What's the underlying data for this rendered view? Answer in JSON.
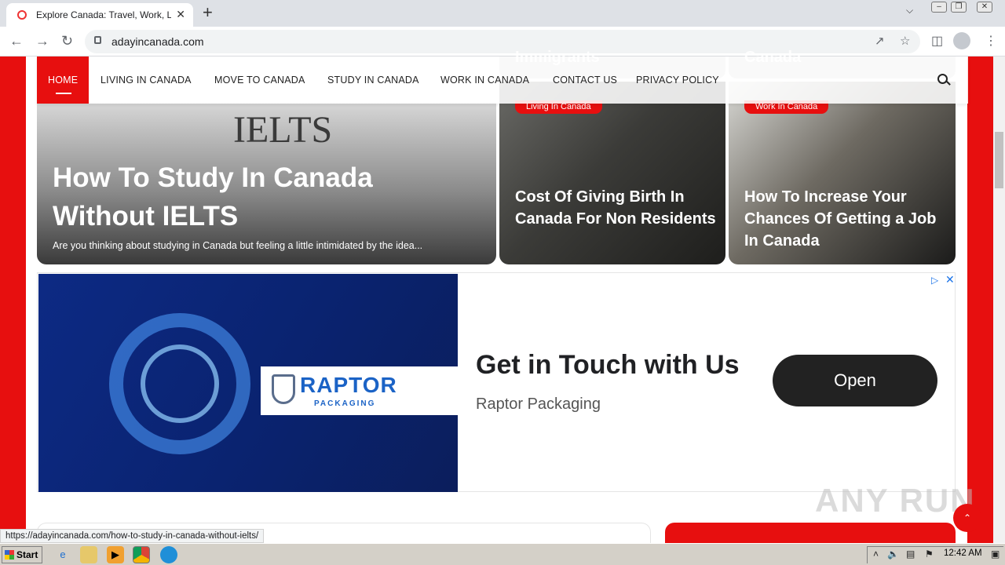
{
  "browser": {
    "tab_title": "Explore Canada: Travel, Work, Live, ...",
    "new_tab": "+",
    "url": "adayincanada.com",
    "status_url": "https://adayincanada.com/how-to-study-in-canada-without-ielts/"
  },
  "nav": {
    "items": [
      {
        "label": "HOME",
        "active": true
      },
      {
        "label": "LIVING IN CANADA",
        "active": false
      },
      {
        "label": "MOVE TO CANADA",
        "active": false
      },
      {
        "label": "STUDY IN CANADA",
        "active": false
      },
      {
        "label": "WORK IN CANADA",
        "active": false
      },
      {
        "label": "CONTACT US",
        "active": false
      },
      {
        "label": "PRIVACY POLICY",
        "active": false
      }
    ]
  },
  "upper_cards": [
    "Immigrants",
    "Canada"
  ],
  "featured": {
    "image_text": "IELTS",
    "title": "How To Study In Canada Without IELTS",
    "excerpt": "Are you thinking about studying in Canada but feeling a little intimidated by the idea..."
  },
  "cards": [
    {
      "category": "Living In Canada",
      "title": "Cost Of Giving Birth In Canada For Non Residents"
    },
    {
      "category": "Work In Canada",
      "title": "How To Increase Your Chances Of Getting a Job In Canada"
    }
  ],
  "ad": {
    "brand_main": "RAPTOR",
    "brand_sub": "PACKAGING",
    "headline": "Get in Touch with Us",
    "advertiser": "Raptor Packaging",
    "button": "Open"
  },
  "watermark": "ANY RUN",
  "taskbar": {
    "start": "Start",
    "clock": "12:42 AM"
  },
  "colors": {
    "accent": "#e70f0f",
    "ad_blue": "#0d2a84"
  }
}
